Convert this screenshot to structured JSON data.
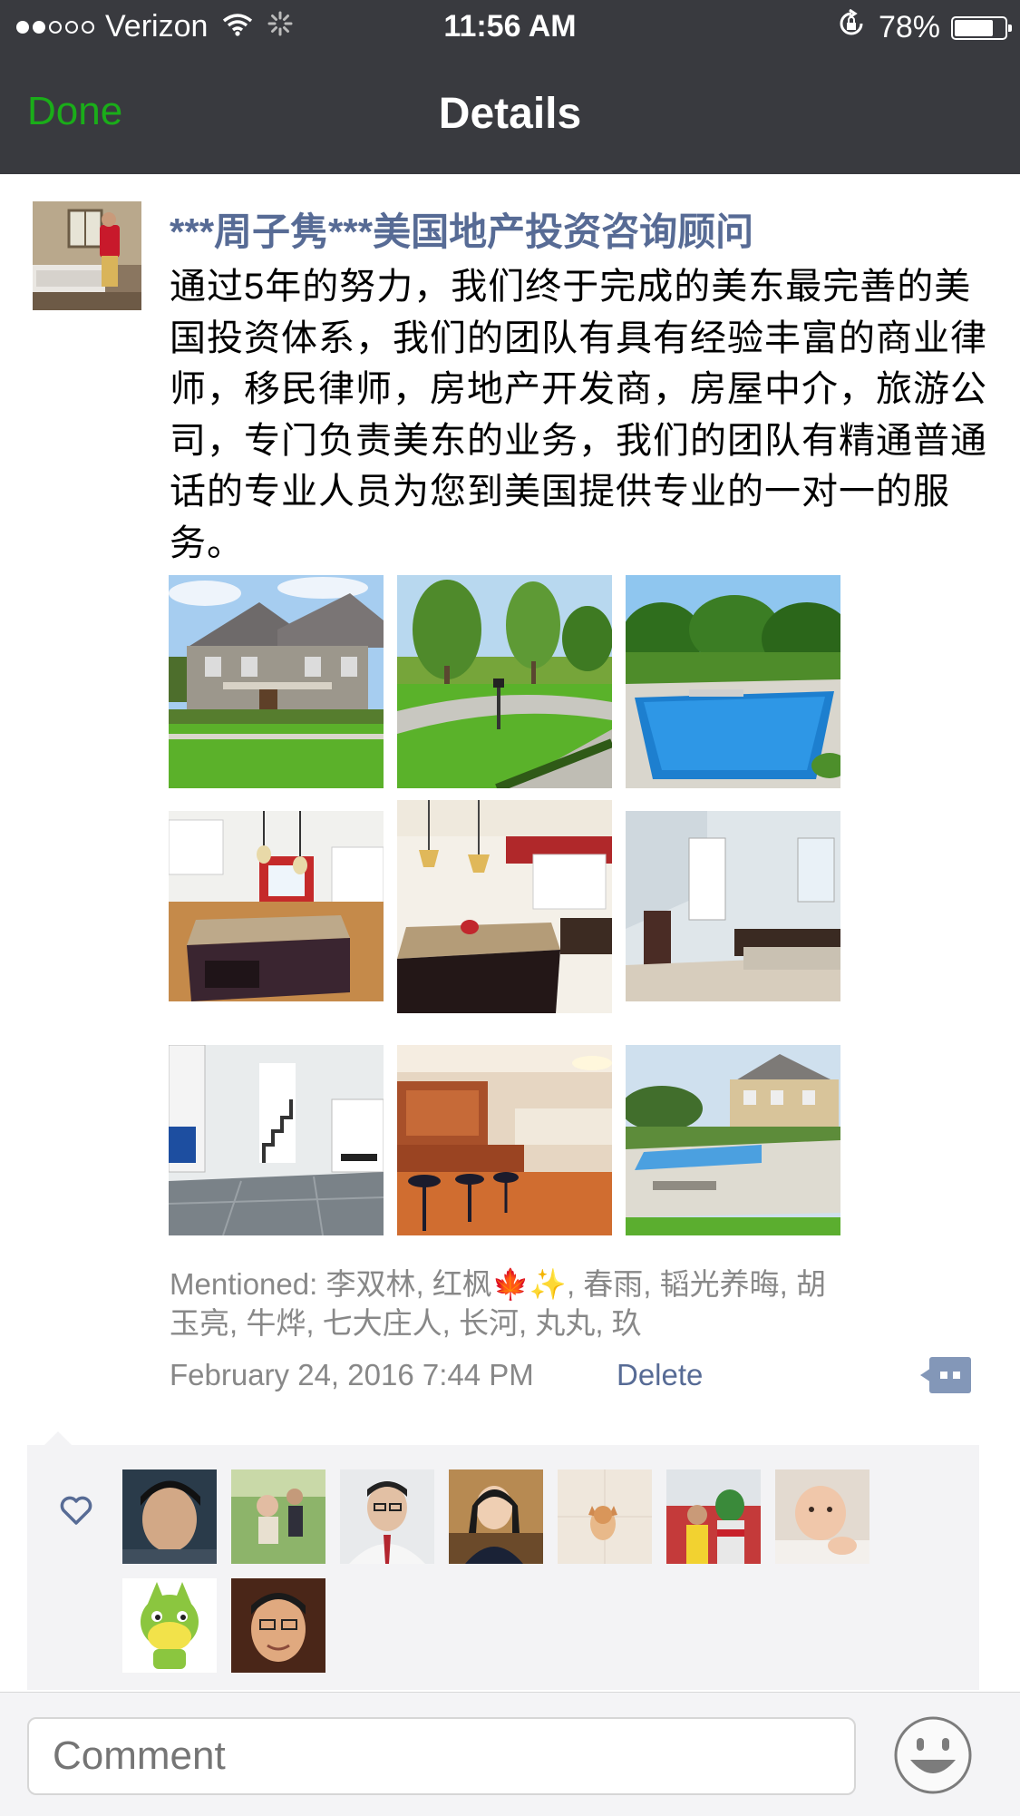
{
  "status_bar": {
    "carrier": "Verizon",
    "time": "11:56 AM",
    "battery": "78%",
    "battery_level": 0.78,
    "signal_dots_filled": 2,
    "signal_dots_total": 5
  },
  "nav": {
    "done_label": "Done",
    "title": "Details"
  },
  "post": {
    "author": "***周子隽***美国地产投资咨询顾问",
    "text": "通过5年的努力，我们终于完成的美东最完善的美国投资体系，我们的团队有具有经验丰富的商业律师，移民律师，房地产开发商，房屋中介，旅游公司，专门负责美东的业务，我们的团队有精通普通话的专业人员为您到美国提供专业的一对一的服务。",
    "photos": [
      {
        "icon": "house-exterior-photo"
      },
      {
        "icon": "lawn-driveway-photo"
      },
      {
        "icon": "swimming-pool-photo"
      },
      {
        "icon": "kitchen-island-photo"
      },
      {
        "icon": "kitchen-dining-photo"
      },
      {
        "icon": "bathroom-photo"
      },
      {
        "icon": "hallway-staircase-photo"
      },
      {
        "icon": "basement-bar-photo"
      },
      {
        "icon": "backyard-pool-house-photo"
      }
    ],
    "mentioned": "Mentioned: 李双林, 红枫🍁✨, 春雨, 韬光养晦, 胡玉亮, 牛烨, 七大庄人, 长河, 丸丸, 玖",
    "date": "February 24, 2016 7:44 PM",
    "delete_label": "Delete"
  },
  "likes": {
    "avatars": [
      {
        "icon": "liker-avatar-1"
      },
      {
        "icon": "liker-avatar-2"
      },
      {
        "icon": "liker-avatar-3"
      },
      {
        "icon": "liker-avatar-4"
      },
      {
        "icon": "liker-avatar-5"
      },
      {
        "icon": "liker-avatar-6"
      },
      {
        "icon": "liker-avatar-7"
      },
      {
        "icon": "liker-avatar-8"
      },
      {
        "icon": "liker-avatar-9"
      }
    ]
  },
  "comment_bar": {
    "placeholder": "Comment"
  },
  "colors": {
    "nav_background": "#393a3f",
    "done_green": "#1aad19",
    "link_blue": "#576b95",
    "meta_gray": "#888888"
  }
}
